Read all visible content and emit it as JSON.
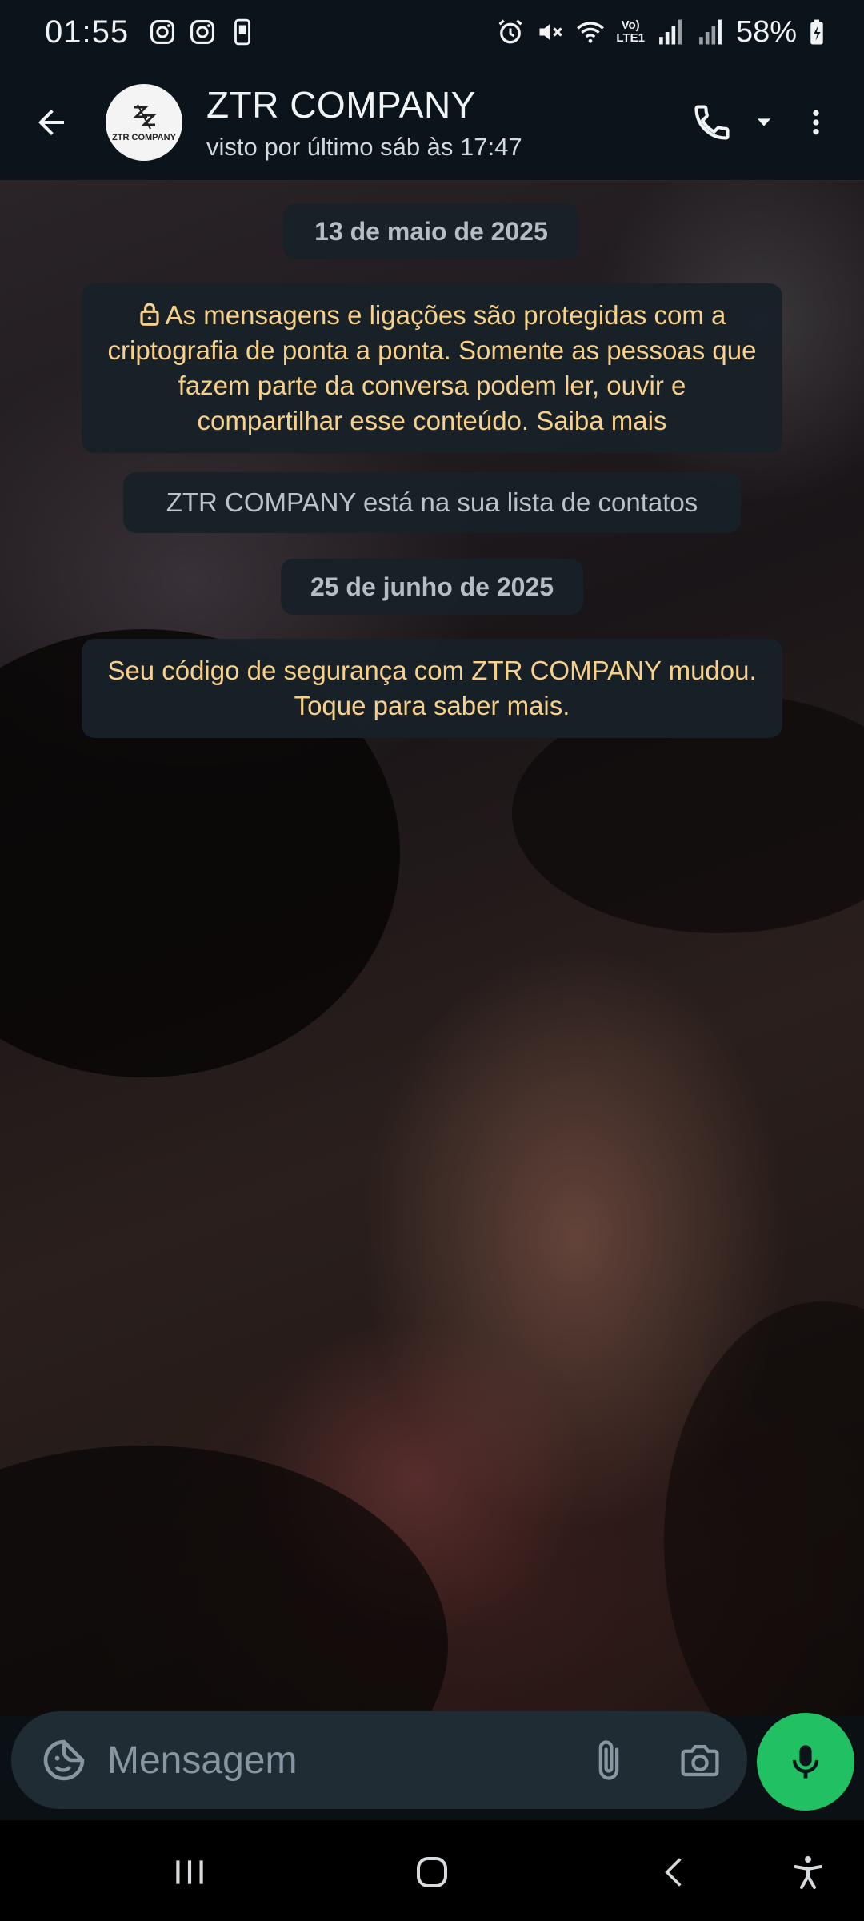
{
  "status_bar": {
    "time": "01:55",
    "battery": "58%",
    "left_icons": [
      "instagram-icon",
      "instagram-icon",
      "phone-notification-icon"
    ],
    "right_icons": [
      "alarm-icon",
      "mute-icon",
      "wifi-icon",
      "volte-icon",
      "signal-icon",
      "signal-icon",
      "battery-charging-icon"
    ],
    "volte_label_top": "Vo)",
    "volte_label_bottom": "LTE1"
  },
  "header": {
    "contact_name": "ZTR COMPANY",
    "avatar_text": "ZTR COMPANY",
    "last_seen": "visto por último sáb às 17:47"
  },
  "chat": {
    "date1": "13 de maio de 2025",
    "encryption_notice": "As mensagens e ligações são protegidas com a criptografia de ponta a ponta. Somente as pessoas que fazem parte da conversa podem ler, ouvir e compartilhar esse conteúdo. Saiba mais",
    "contact_notice": "ZTR COMPANY está na sua lista de contatos",
    "date2": "25 de junho de 2025",
    "security_notice": "Seu código de segurança com ZTR COMPANY mudou. Toque para saber mais."
  },
  "input": {
    "placeholder": "Mensagem"
  },
  "colors": {
    "accent": "#21c063",
    "notice_text": "#f7d08a",
    "bubble_bg": "#182128"
  }
}
